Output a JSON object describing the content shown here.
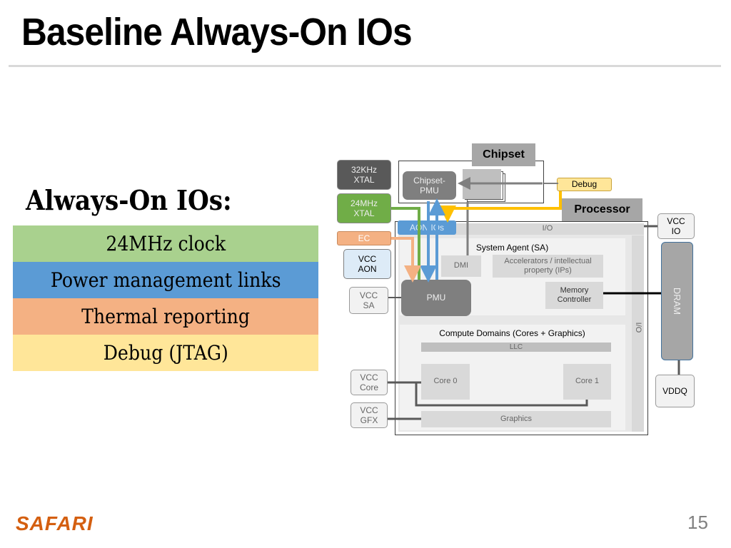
{
  "slide": {
    "title": "Baseline Always-On IOs",
    "page_number": "15",
    "footer_logo": "SAFARI"
  },
  "always_on": {
    "heading": "Always-On IOs:",
    "items": [
      {
        "label": "24MHz clock",
        "color": "#a9d18e"
      },
      {
        "label": "Power management links",
        "color": "#5b9bd5"
      },
      {
        "label": "Thermal reporting",
        "color": "#f4b183"
      },
      {
        "label": "Debug (JTAG)",
        "color": "#ffe699"
      }
    ]
  },
  "diagram": {
    "chipset": {
      "label": "Chipset",
      "pmu": "Chipset-\nPMU"
    },
    "processor": {
      "label": "Processor"
    },
    "external": {
      "xtal32": "32KHz\nXTAL",
      "xtal24": "24MHz\nXTAL",
      "ec": "EC",
      "vcc_aon": "VCC\nAON",
      "vcc_sa": "VCC\nSA",
      "vcc_core": "VCC\nCore",
      "vcc_gfx": "VCC\nGFX",
      "debug": "Debug",
      "vcc_io": "VCC\nIO",
      "dram": "DRAM",
      "vddq": "VDDQ"
    },
    "internal": {
      "aon_ios": "AON IOs",
      "io_top": "I/O",
      "io_side": "I/O",
      "system_agent": "System Agent (SA)",
      "dmi": "DMI",
      "accelerators": "Accelerators / intellectual\nproperty (IPs)",
      "memory_controller": "Memory\nController",
      "pmu": "PMU",
      "compute_domains": "Compute Domains (Cores + Graphics)",
      "llc": "LLC",
      "core0": "Core 0",
      "core1": "Core 1",
      "graphics": "Graphics"
    },
    "colors": {
      "clock": "#70ad47",
      "pm_links": "#5b9bd5",
      "thermal": "#f4b183",
      "debug": "#ffc000"
    }
  }
}
